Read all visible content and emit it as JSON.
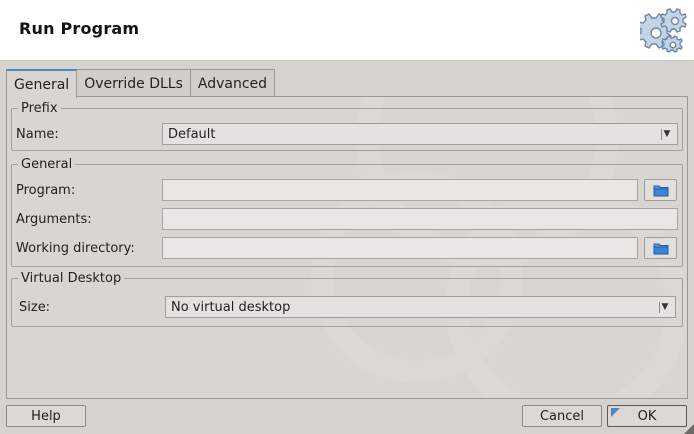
{
  "window": {
    "title": "Run Program"
  },
  "header_icon": "gears-icon",
  "tabs": [
    {
      "label": "General",
      "active": true
    },
    {
      "label": "Override DLLs",
      "active": false
    },
    {
      "label": "Advanced",
      "active": false
    }
  ],
  "prefix": {
    "legend": "Prefix",
    "name_label": "Name:",
    "name_value": "Default"
  },
  "general": {
    "legend": "General",
    "program_label": "Program:",
    "program_value": "",
    "arguments_label": "Arguments:",
    "arguments_value": "",
    "workdir_label": "Working directory:",
    "workdir_value": ""
  },
  "virtual_desktop": {
    "legend": "Virtual Desktop",
    "size_label": "Size:",
    "size_value": "No virtual desktop"
  },
  "buttons": {
    "help": "Help",
    "cancel": "Cancel",
    "ok": "OK"
  },
  "colors": {
    "accent": "#4d87c7",
    "folder": "#2f6fc0",
    "background": "#d6d3cf"
  }
}
